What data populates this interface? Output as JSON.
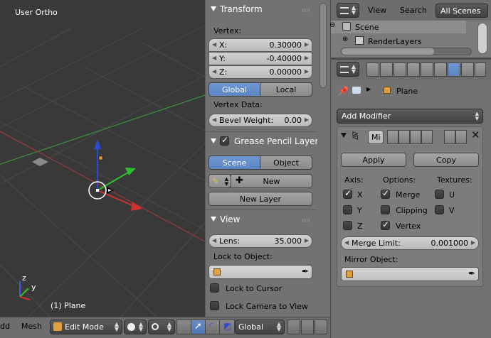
{
  "viewport": {
    "view_label": "User Ortho",
    "object_label": "(1) Plane",
    "axis_z": "z",
    "axis_y": "y"
  },
  "bottom_bar": {
    "view_menu": "dd",
    "mesh_menu": "Mesh",
    "mode": "Edit Mode",
    "orientation": "Global"
  },
  "transform": {
    "title": "Transform",
    "vertex_label": "Vertex:",
    "x_label": "X:",
    "x_value": "0.30000",
    "y_label": "Y:",
    "y_value": "-0.40000",
    "z_label": "Z:",
    "z_value": "0.00000",
    "global_label": "Global",
    "local_label": "Local",
    "vertex_data_label": "Vertex Data:",
    "bevel_label": "Bevel Weight:",
    "bevel_value": "0.00"
  },
  "grease_pencil": {
    "title": "Grease Pencil Layers",
    "scene_label": "Scene",
    "object_label": "Object",
    "new_label": "New",
    "new_layer_label": "New Layer"
  },
  "view": {
    "title": "View",
    "lens_label": "Lens:",
    "lens_value": "35.000",
    "lock_to_object_label": "Lock to Object:",
    "lock_to_cursor_label": "Lock to Cursor",
    "lock_camera_label": "Lock Camera to View"
  },
  "outliner": {
    "view_menu": "View",
    "search_menu": "Search",
    "filter": "All Scenes",
    "items": [
      {
        "label": "Scene"
      },
      {
        "label": "RenderLayers"
      }
    ]
  },
  "properties": {
    "breadcrumb_object": "Plane",
    "add_modifier_label": "Add Modifier",
    "modifier_name": "Mi",
    "apply_label": "Apply",
    "copy_label": "Copy",
    "axis_header": "Axis:",
    "options_header": "Options:",
    "textures_header": "Textures:",
    "axis": [
      {
        "label": "X",
        "checked": true
      },
      {
        "label": "Y",
        "checked": false
      },
      {
        "label": "Z",
        "checked": false
      }
    ],
    "options": [
      {
        "label": "Merge",
        "checked": true
      },
      {
        "label": "Clipping",
        "checked": false
      },
      {
        "label": "Vertex",
        "checked": true
      }
    ],
    "textures": [
      {
        "label": "U",
        "checked": false
      },
      {
        "label": "V",
        "checked": false
      }
    ],
    "merge_limit_label": "Merge Limit:",
    "merge_limit_value": "0.001000",
    "mirror_object_label": "Mirror Object:"
  },
  "colors": {
    "selection_blue": "#5a84c3",
    "axis_red": "#d03030",
    "axis_green": "#30c030",
    "axis_blue": "#2a4ad8"
  }
}
